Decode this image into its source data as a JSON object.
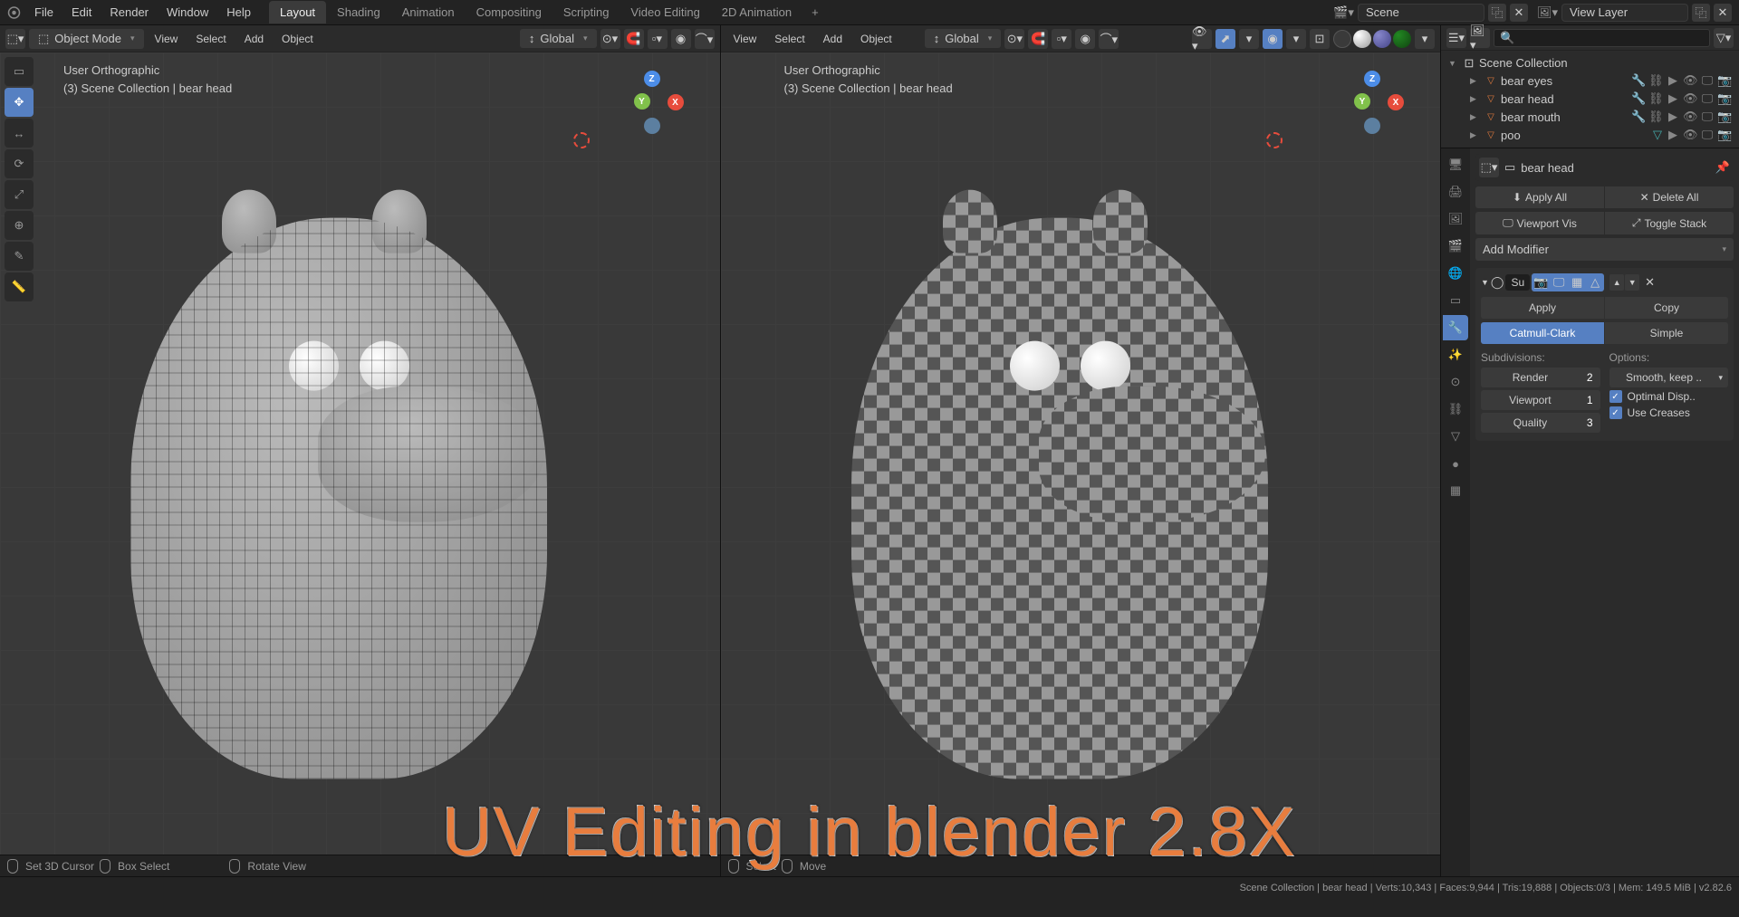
{
  "topbar": {
    "menus": [
      "File",
      "Edit",
      "Render",
      "Window",
      "Help"
    ],
    "workspaces": [
      "Layout",
      "Shading",
      "Animation",
      "Compositing",
      "Scripting",
      "Video Editing",
      "2D Animation"
    ],
    "active_workspace": 0,
    "scene_label": "Scene",
    "layer_label": "View Layer"
  },
  "viewport_header": {
    "mode": "Object Mode",
    "menus": [
      "View",
      "Select",
      "Add",
      "Object"
    ],
    "orientation": "Global"
  },
  "viewport_info": {
    "view": "User Orthographic",
    "path": "(3) Scene Collection | bear head"
  },
  "bottom_tools": {
    "left": [
      {
        "icon": "⊕",
        "label": "Set 3D Cursor"
      },
      {
        "icon": "▭",
        "label": "Box Select"
      },
      {
        "icon": "⟳",
        "label": "Rotate View"
      }
    ],
    "right": [
      {
        "icon": "▭",
        "label": "Select"
      },
      {
        "icon": "✥",
        "label": "Move"
      }
    ]
  },
  "outliner": {
    "collection": "Scene Collection",
    "items": [
      {
        "name": "bear eyes",
        "icons": [
          "🔧",
          "⛓",
          "👁",
          "📷"
        ]
      },
      {
        "name": "bear head",
        "icons": [
          "🔧",
          "⛓",
          "👁",
          "📷"
        ]
      },
      {
        "name": "bear mouth",
        "icons": [
          "🔧",
          "⛓",
          "👁",
          "📷"
        ]
      },
      {
        "name": "poo",
        "icons": [
          "👁",
          "📷"
        ]
      }
    ]
  },
  "properties": {
    "context": "bear head",
    "apply_all": "Apply All",
    "delete_all": "Delete All",
    "viewport_vis": "Viewport Vis",
    "toggle_stack": "Toggle Stack",
    "add_modifier": "Add Modifier",
    "mod_name": "Su",
    "apply": "Apply",
    "copy": "Copy",
    "algo_active": "Catmull-Clark",
    "algo_other": "Simple",
    "subdiv_label": "Subdivisions:",
    "options_label": "Options:",
    "render_label": "Render",
    "render_val": "2",
    "viewport_label": "Viewport",
    "viewport_val": "1",
    "quality_label": "Quality",
    "quality_val": "3",
    "smooth_opt": "Smooth, keep ..",
    "optimal_disp": "Optimal Disp..",
    "use_creases": "Use Creases"
  },
  "status": {
    "text": "Scene Collection | bear head | Verts:10,343 | Faces:9,944 | Tris:19,888 | Objects:0/3 | Mem: 149.5 MiB | v2.82.6"
  },
  "overlay": "UV Editing in blender 2.8X"
}
